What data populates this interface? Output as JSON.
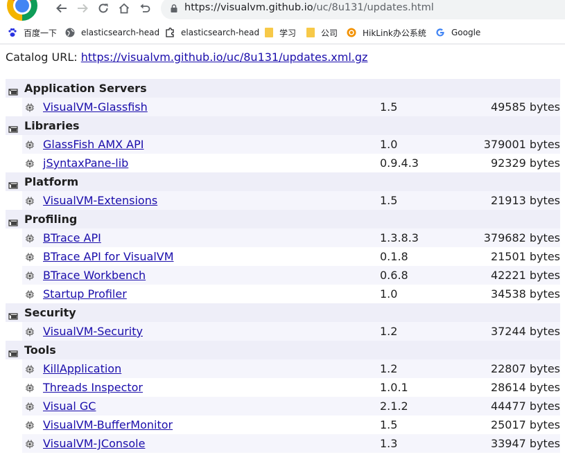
{
  "browser": {
    "url_prefix": "https://visualvm.github.io",
    "url_path": "/uc/8u131/updates.html",
    "bookmarks": [
      {
        "label": "百度一下",
        "icon": "baidu-paw-icon"
      },
      {
        "label": "elasticsearch-head",
        "icon": "globe-icon"
      },
      {
        "label": "elasticsearch-head",
        "icon": "puzzle-icon"
      },
      {
        "label": "学习",
        "icon": "folder-icon"
      },
      {
        "label": "公司",
        "icon": "folder-icon"
      },
      {
        "label": "HikLink办公系统",
        "icon": "hiklink-icon"
      },
      {
        "label": "Google",
        "icon": "google-icon"
      }
    ]
  },
  "page": {
    "catalog_label": "Catalog URL:",
    "catalog_url": "https://visualvm.github.io/uc/8u131/updates.xml.gz"
  },
  "rows": [
    {
      "category": "Application Servers"
    },
    {
      "name": "VisualVM-Glassfish",
      "version": "1.5",
      "size": "49585 bytes"
    },
    {
      "category": "Libraries"
    },
    {
      "name": "GlassFish AMX API",
      "version": "1.0",
      "size": "379001 bytes"
    },
    {
      "name": "jSyntaxPane-lib",
      "version": "0.9.4.3",
      "size": "92329 bytes"
    },
    {
      "category": "Platform"
    },
    {
      "name": "VisualVM-Extensions",
      "version": "1.5",
      "size": "21913 bytes"
    },
    {
      "category": "Profiling"
    },
    {
      "name": "BTrace API",
      "version": "1.3.8.3",
      "size": "379682 bytes"
    },
    {
      "name": "BTrace API for VisualVM",
      "version": "0.1.8",
      "size": "21501 bytes"
    },
    {
      "name": "BTrace Workbench",
      "version": "0.6.8",
      "size": "42221 bytes"
    },
    {
      "name": "Startup Profiler",
      "version": "1.0",
      "size": "34538 bytes"
    },
    {
      "category": "Security"
    },
    {
      "name": "VisualVM-Security",
      "version": "1.2",
      "size": "37244 bytes"
    },
    {
      "category": "Tools"
    },
    {
      "name": "KillApplication",
      "version": "1.2",
      "size": "22807 bytes"
    },
    {
      "name": "Threads Inspector",
      "version": "1.0.1",
      "size": "28614 bytes"
    },
    {
      "name": "Visual GC",
      "version": "2.1.2",
      "size": "44477 bytes"
    },
    {
      "name": "VisualVM-BufferMonitor",
      "version": "1.5",
      "size": "25017 bytes"
    },
    {
      "name": "VisualVM-JConsole",
      "version": "1.3",
      "size": "33947 bytes"
    }
  ]
}
